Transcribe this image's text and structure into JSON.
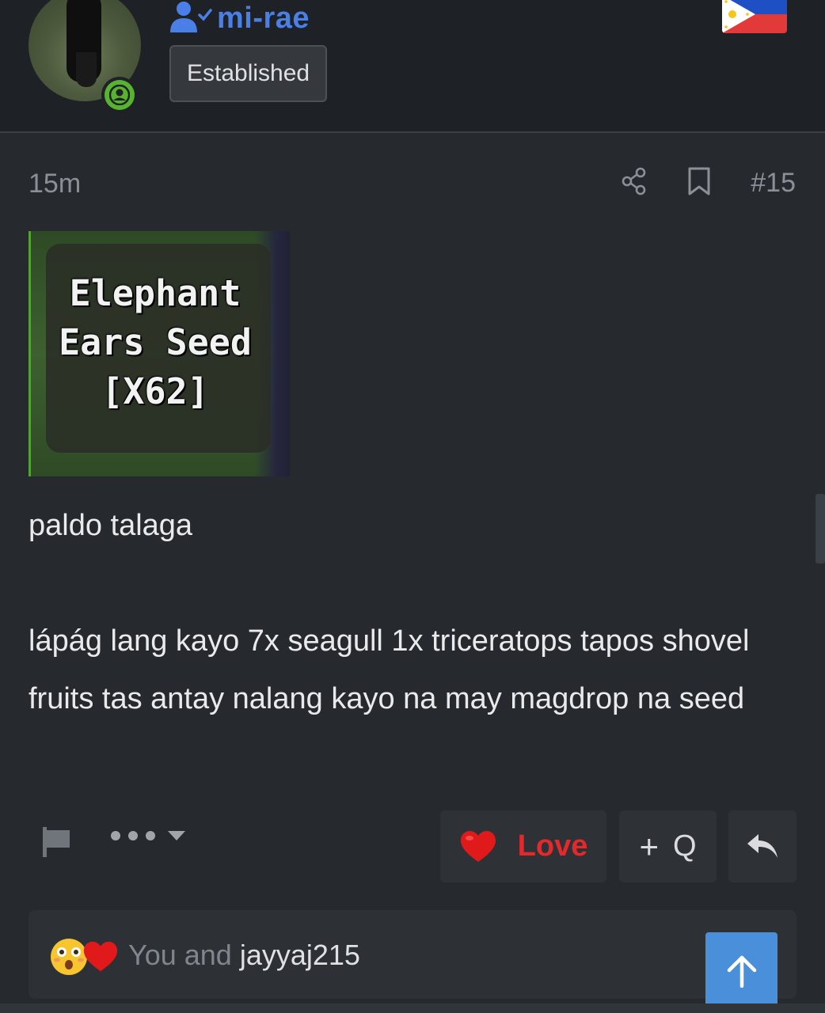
{
  "user": {
    "name": "mi-rae",
    "badge": "Established",
    "flag_icon": "philippines-flag-icon",
    "status_icon": "online-user-icon",
    "name_color": "#4a7fe8"
  },
  "post": {
    "time": "15m",
    "number": "#15",
    "attachment": {
      "caption_line1": "Elephant",
      "caption_line2": "Ears Seed",
      "caption_line3": "[X62]"
    },
    "paragraphs": [
      "paldo talaga",
      "lápág lang kayo 7x seagull 1x triceratops tapos shovel fruits tas antay nalang kayo na may magdrop na seed"
    ]
  },
  "actions": {
    "love_label": "Love",
    "quote_label": "Q",
    "quote_plus": "+",
    "love_color": "#e6282b"
  },
  "reactions": {
    "you_text": "You and",
    "user": "jayyaj215",
    "icons": [
      "astonished-emoji-icon",
      "heart-icon"
    ]
  }
}
